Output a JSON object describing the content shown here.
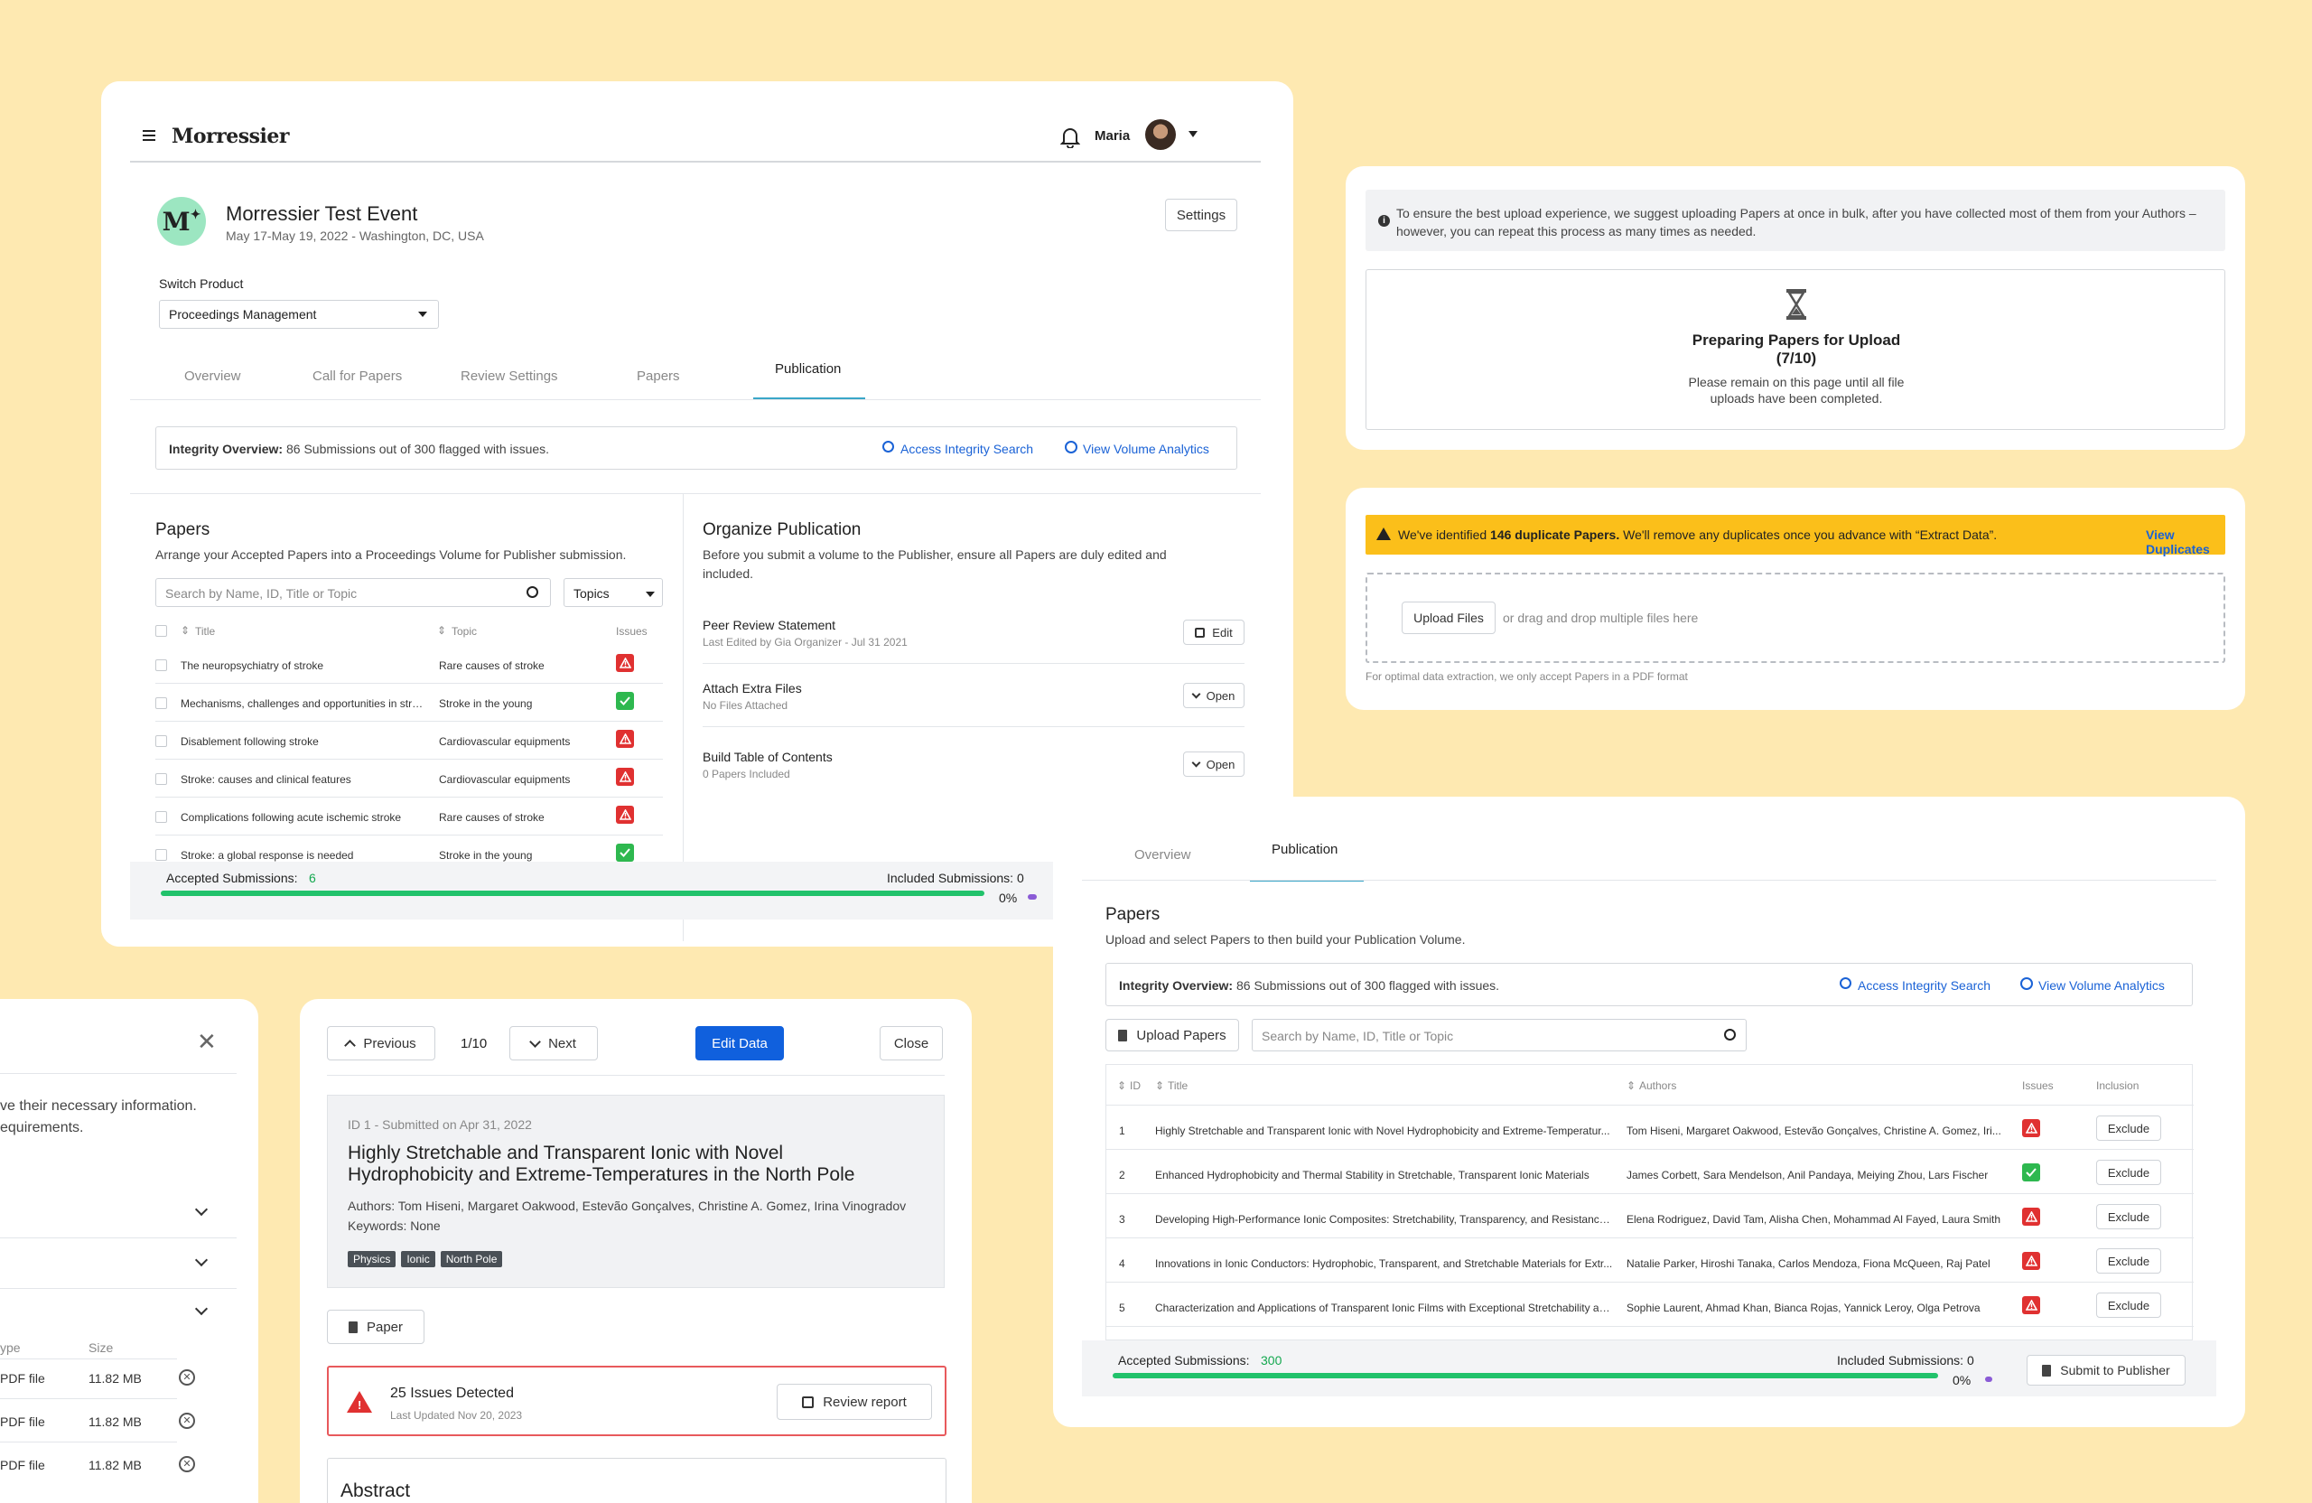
{
  "app": {
    "brand": "Morressier",
    "user_name": "Maria",
    "event_title": "Morressier Test Event",
    "event_meta": "May 17-May 19, 2022 - Washington, DC, USA",
    "settings_label": "Settings",
    "switch_product_label": "Switch Product",
    "switch_product_value": "Proceedings Management",
    "tabs": [
      "Overview",
      "Call for Papers",
      "Review Settings",
      "Papers",
      "Publication"
    ],
    "active_tab": "Publication",
    "integrity_label": "Integrity Overview:",
    "integrity_text": "86 Submissions out of 300 flagged with issues.",
    "access_integrity": "Access Integrity Search",
    "view_analytics": "View Volume Analytics",
    "papers_title": "Papers",
    "papers_desc": "Arrange your Accepted Papers into a Proceedings Volume for Publisher submission.",
    "search_placeholder": "Search by Name, ID, Title or Topic",
    "topics_label": "Topics",
    "col_title": "Title",
    "col_topic": "Topic",
    "col_issues": "Issues",
    "rows": [
      {
        "title": "The neuropsychiatry of stroke",
        "topic": "Rare causes of stroke",
        "issue": "warning"
      },
      {
        "title": "Mechanisms, challenges and opportunities in stro...",
        "topic": "Stroke in the young",
        "issue": "ok"
      },
      {
        "title": "Disablement following stroke",
        "topic": "Cardiovascular equipments",
        "issue": "warning"
      },
      {
        "title": "Stroke: causes and clinical features",
        "topic": "Cardiovascular equipments",
        "issue": "warning"
      },
      {
        "title": "Complications following acute ischemic stroke",
        "topic": "Rare causes of stroke",
        "issue": "warning"
      },
      {
        "title": "Stroke: a global response is needed",
        "topic": "Stroke in the young",
        "issue": "ok"
      }
    ],
    "organize_title": "Organize Publication",
    "organize_desc": "Before you submit a volume to the Publisher, ensure all Papers are duly edited and included.",
    "org_items": [
      {
        "title": "Peer Review Statement",
        "sub": "Last Edited by Gia Organizer - Jul 31 2021",
        "action": "Edit"
      },
      {
        "title": "Attach Extra Files",
        "sub": "No Files Attached",
        "action": "Open"
      },
      {
        "title": "Build Table of Contents",
        "sub": "0 Papers Included",
        "action": "Open"
      }
    ],
    "accepted_label": "Accepted Submissions:",
    "accepted_value": "6",
    "included_label": "Included Submissions: 0",
    "progress_pct": "0%",
    "progress_fraction": 1.0
  },
  "upload_card": {
    "info": "To ensure the best upload experience, we suggest uploading Papers at once in bulk, after you have collected most of them from your Authors – however, you can repeat this process as many times as needed.",
    "preparing_title": "Preparing Papers for Upload",
    "preparing_count": "(7/10)",
    "preparing_sub1": "Please remain on this page until all file",
    "preparing_sub2": "uploads have been completed."
  },
  "dup_card": {
    "warn_pre": "We've identified ",
    "warn_bold": "146 duplicate Papers.",
    "warn_post": " We'll remove any duplicates once you advance with “Extract Data”.",
    "view_duplicates": "View Duplicates",
    "upload_files": "Upload Files",
    "drag_text": "or drag and drop multiple files here",
    "hint": "For optimal data extraction, we only accept Papers in a PDF format"
  },
  "pub_card": {
    "tabs": [
      "Overview",
      "Publication"
    ],
    "active_tab": "Publication",
    "title": "Papers",
    "desc": "Upload and select Papers to then build your Publication Volume.",
    "integrity_label": "Integrity Overview:",
    "integrity_text": "86 Submissions out of 300 flagged with issues.",
    "access_integrity": "Access Integrity Search",
    "view_analytics": "View Volume Analytics",
    "upload_papers": "Upload Papers",
    "search_placeholder": "Search by Name, ID, Title or Topic",
    "col_id": "ID",
    "col_title": "Title",
    "col_authors": "Authors",
    "col_issues": "Issues",
    "col_inclusion": "Inclusion",
    "exclude_label": "Exclude",
    "rows": [
      {
        "id": "1",
        "title": "Highly Stretchable and Transparent Ionic with Novel Hydrophobicity and Extreme-Temperatur...",
        "authors": "Tom Hiseni, Margaret Oakwood, Estevão Gonçalves, Christine A. Gomez, Iri...",
        "issue": "warning"
      },
      {
        "id": "2",
        "title": "Enhanced Hydrophobicity and Thermal Stability in Stretchable, Transparent Ionic Materials",
        "authors": "James Corbett, Sara Mendelson, Anil Pandaya, Meiying Zhou, Lars Fischer",
        "issue": "ok"
      },
      {
        "id": "3",
        "title": "Developing High-Performance Ionic Composites: Stretchability, Transparency, and Resistance t...",
        "authors": "Elena Rodriguez, David Tam, Alisha Chen, Mohammad Al Fayed, Laura Smith",
        "issue": "warning"
      },
      {
        "id": "4",
        "title": "Innovations in Ionic Conductors: Hydrophobic, Transparent, and Stretchable Materials for Extr...",
        "authors": "Natalie Parker, Hiroshi Tanaka, Carlos Mendoza, Fiona McQueen, Raj Patel",
        "issue": "warning"
      },
      {
        "id": "5",
        "title": "Characterization and Applications of Transparent Ionic Films with Exceptional Stretchability an...",
        "authors": "Sophie Laurent, Ahmad Khan, Bianca Rojas, Yannick Leroy, Olga Petrova",
        "issue": "warning"
      }
    ],
    "accepted_label": "Accepted Submissions:",
    "accepted_value": "300",
    "included_label": "Included Submissions: 0",
    "progress_pct": "0%",
    "progress_fraction": 1.0,
    "submit_label": "Submit to Publisher"
  },
  "side_card": {
    "text1": "ve their necessary information.",
    "text2": "equirements.",
    "col_type": "ype",
    "col_size": "Size",
    "files": [
      {
        "type": "PDF file",
        "size": "11.82 MB"
      },
      {
        "type": "PDF file",
        "size": "11.82 MB"
      },
      {
        "type": "PDF file",
        "size": "11.82 MB"
      }
    ]
  },
  "detail_card": {
    "previous": "Previous",
    "pager": "1/10",
    "next": "Next",
    "edit_data": "Edit Data",
    "close": "Close",
    "submitted": "ID 1 - Submitted on Apr 31, 2022",
    "title_line1": "Highly Stretchable and Transparent Ionic with Novel",
    "title_line2": "Hydrophobicity and Extreme-Temperatures in the North Pole",
    "authors": "Authors: Tom Hiseni, Margaret Oakwood, Estevão Gonçalves, Christine A. Gomez, Irina Vinogradov",
    "keywords": "Keywords: None",
    "tags": [
      "Physics",
      "Ionic",
      "North Pole"
    ],
    "paper_label": "Paper",
    "issues_title": "25 Issues Detected",
    "issues_updated": "Last Updated Nov 20, 2023",
    "review_report": "Review report",
    "abstract": "Abstract"
  },
  "colors": {
    "background": "#fee9b1",
    "primary": "#1a62d6",
    "success": "#21c26b",
    "danger": "#e03131",
    "warning_bar": "#fbbf1a"
  }
}
